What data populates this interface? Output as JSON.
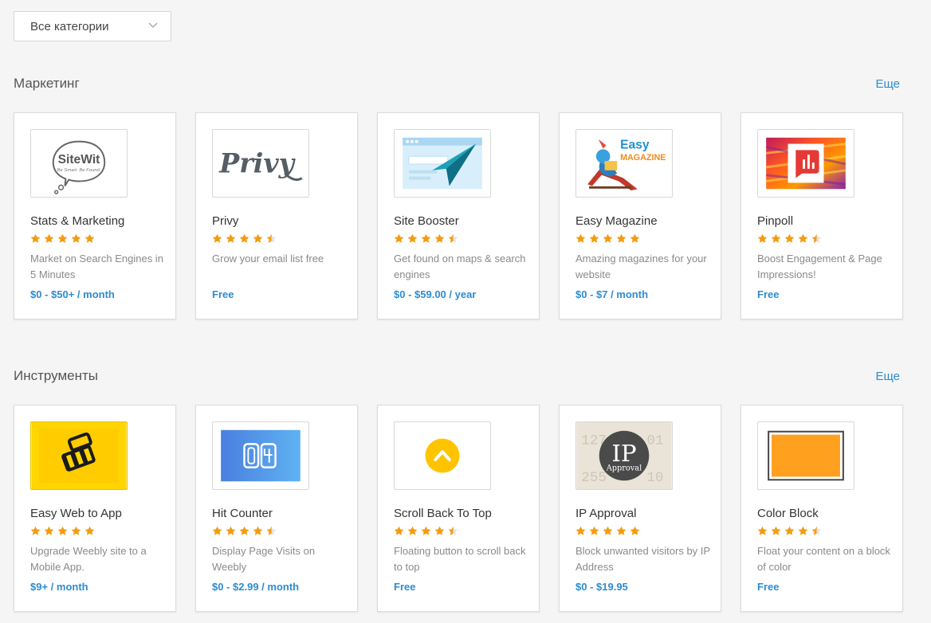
{
  "filter": {
    "label": "Все категории"
  },
  "sections": [
    {
      "title": "Маркетинг",
      "more": "Еще",
      "apps": [
        {
          "name": "Stats & Marketing",
          "rating": 5,
          "description": "Market on Search Engines in 5 Minutes",
          "price": "$0 - $50+ / month",
          "logo": {
            "icon": "sitewit-logo",
            "text": "SiteWit",
            "tagline": "Be Smart. Be Found."
          }
        },
        {
          "name": "Privy",
          "rating": 4.5,
          "description": "Grow your email list free",
          "price": "Free",
          "logo": {
            "icon": "privy-logo",
            "text": "Privy"
          }
        },
        {
          "name": "Site Booster",
          "rating": 4.5,
          "description": "Get found on maps & search engines",
          "price": "$0 - $59.00 / year",
          "logo": {
            "icon": "site-booster-logo"
          }
        },
        {
          "name": "Easy Magazine",
          "rating": 5,
          "description": "Amazing magazines for your website",
          "price": "$0 - $7 / month",
          "logo": {
            "icon": "easy-magazine-logo",
            "text1": "Easy",
            "text2": "MAGAZINE"
          }
        },
        {
          "name": "Pinpoll",
          "rating": 4.5,
          "description": "Boost Engagement & Page Impressions!",
          "price": "Free",
          "logo": {
            "icon": "pinpoll-logo"
          }
        }
      ]
    },
    {
      "title": "Инструменты",
      "more": "Еще",
      "apps": [
        {
          "name": "Easy Web to App",
          "rating": 5,
          "description": "Upgrade Weebly site to a Mobile App.",
          "price": "$9+ / month",
          "logo": {
            "icon": "easy-web-to-app-logo"
          }
        },
        {
          "name": "Hit Counter",
          "rating": 4.5,
          "description": "Display Page Visits on Weebly",
          "price": "$0 - $2.99 / month",
          "logo": {
            "icon": "hit-counter-logo"
          }
        },
        {
          "name": "Scroll Back To Top",
          "rating": 4.5,
          "description": "Floating button to scroll back to top",
          "price": "Free",
          "logo": {
            "icon": "scroll-back-to-top-logo"
          }
        },
        {
          "name": "IP Approval",
          "rating": 5,
          "description": "Block unwanted visitors by IP Address",
          "price": "$0 - $19.95",
          "logo": {
            "icon": "ip-approval-logo",
            "text1": "IP",
            "text2": "Approval"
          }
        },
        {
          "name": "Color Block",
          "rating": 4.5,
          "description": "Float your content on a block of color",
          "price": "Free",
          "logo": {
            "icon": "color-block-logo"
          }
        }
      ]
    }
  ],
  "colors": {
    "accent": "#2d8ccf",
    "star": "#f39c12"
  }
}
